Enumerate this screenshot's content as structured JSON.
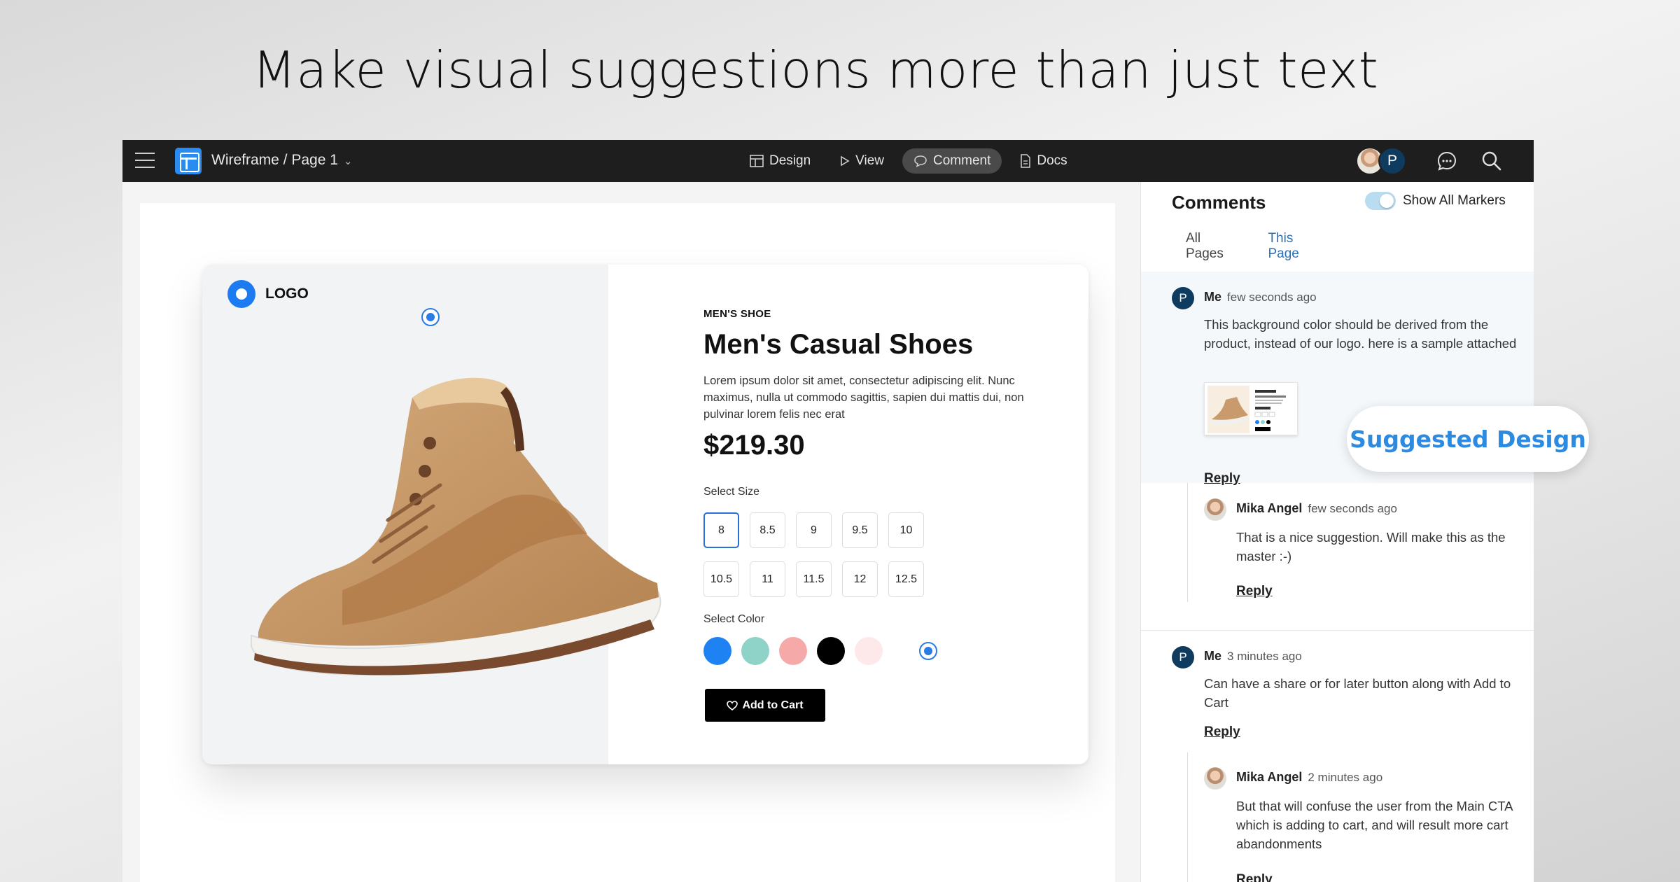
{
  "headline": "Make visual suggestions more than just text",
  "topbar": {
    "breadcrumb": "Wireframe / Page 1",
    "nav": [
      {
        "label": "Design",
        "icon": "layout-icon"
      },
      {
        "label": "View",
        "icon": "play-icon"
      },
      {
        "label": "Comment",
        "icon": "speech-bubble-icon",
        "active": true
      },
      {
        "label": "Docs",
        "icon": "document-icon"
      }
    ],
    "user_initial": "P"
  },
  "product_card": {
    "logo_text": "LOGO",
    "kicker": "MEN'S SHOE",
    "title": "Men's Casual Shoes",
    "description": "Lorem ipsum dolor sit amet, consectetur adipiscing elit. Nunc maximus, nulla ut commodo sagittis, sapien dui mattis dui, non pulvinar lorem felis nec erat",
    "price": "$219.30",
    "size_label": "Select Size",
    "sizes": [
      "8",
      "8.5",
      "9",
      "9.5",
      "10",
      "10.5",
      "11",
      "11.5",
      "12",
      "12.5"
    ],
    "selected_size": "8",
    "color_label": "Select Color",
    "colors": [
      "#1e82f2",
      "#8fd3c8",
      "#f5a9a9",
      "#000000",
      "#fde9ea"
    ],
    "cart_button": "Add to Cart"
  },
  "comments": {
    "title": "Comments",
    "toggle_label": "Show All Markers",
    "toggle_on": true,
    "tabs": [
      "All Pages",
      "This Page"
    ],
    "reply_label": "Reply",
    "items": [
      {
        "initial": "P",
        "author": "Me",
        "time": "few seconds ago",
        "text": "This background color should be derived from the product, instead of our logo. here is a sample attached"
      },
      {
        "author": "Mika Angel",
        "time": "few seconds ago",
        "text": "That is a nice suggestion. Will make this as the master :-)"
      },
      {
        "initial": "P",
        "author": "Me",
        "time": "3 minutes ago",
        "text": "Can have a share or for later button along with Add to Cart"
      },
      {
        "author": "Mika Angel",
        "time": "2 minutes ago",
        "text": "But that will confuse the user from the Main CTA which is adding to cart, and will result more cart abandonments"
      }
    ]
  },
  "callout": "Suggested Design",
  "accent_color": "#2a7be4"
}
